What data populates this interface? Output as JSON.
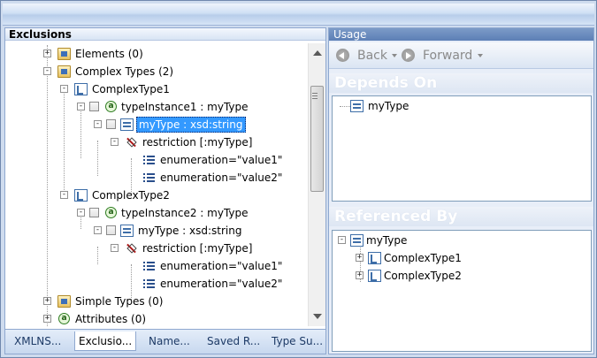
{
  "left": {
    "title": "Exclusions",
    "tree": {
      "elements": "Elements (0)",
      "complex_types": "Complex Types (2)",
      "ct1": "ComplexType1",
      "ti1": "typeInstance1 : myType",
      "mytype_sel": "myType : xsd:string",
      "restr1": "restriction [:myType]",
      "enum1a": "enumeration=\"value1\"",
      "enum1b": "enumeration=\"value2\"",
      "ct2": "ComplexType2",
      "ti2": "typeInstance2 : myType",
      "mytype2": "myType : xsd:string",
      "restr2": "restriction [:myType]",
      "enum2a": "enumeration=\"value1\"",
      "enum2b": "enumeration=\"value2\"",
      "simple_types": "Simple Types (0)",
      "attributes": "Attributes (0)"
    },
    "tabs": [
      "XMLNS...",
      "Exclusio...",
      "Name...",
      "Saved R...",
      "Type Su..."
    ]
  },
  "right": {
    "title": "Usage",
    "back": "Back",
    "forward": "Forward",
    "depends_on": "Depends On",
    "depends_items": [
      "myType"
    ],
    "referenced_by": "Referenced By",
    "ref_root": "myType",
    "ref_children": [
      "ComplexType1",
      "ComplexType2"
    ]
  }
}
